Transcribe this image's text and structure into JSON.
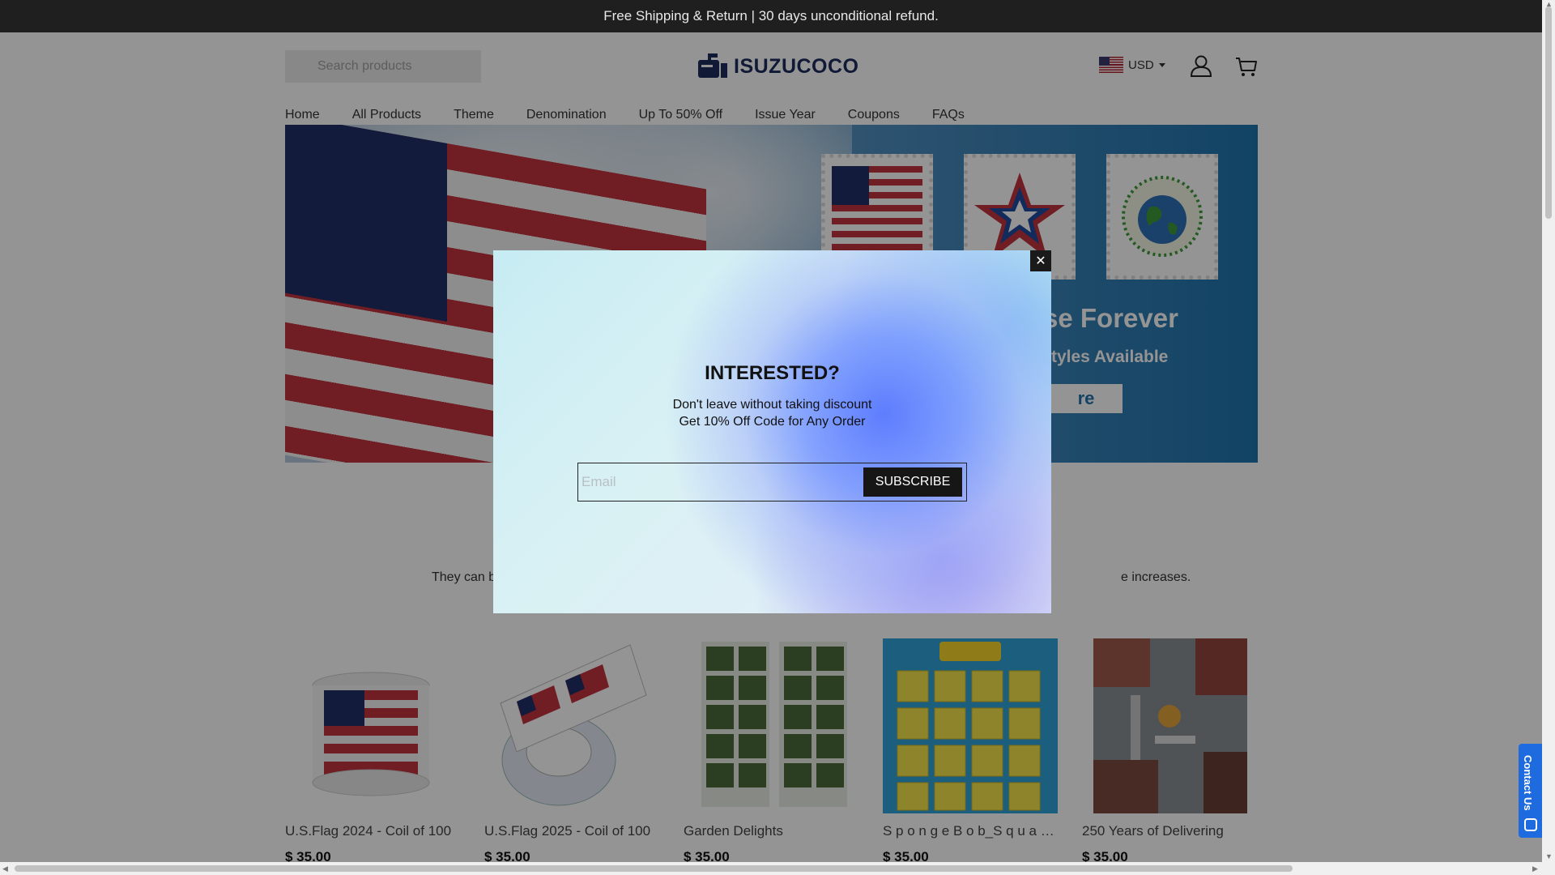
{
  "announcement": "Free Shipping & Return | 30 days unconditional refund.",
  "header": {
    "search_placeholder": "Search products",
    "logo_text": "ISUZUCOCO",
    "currency": "USD"
  },
  "nav": [
    "Home",
    "All Products",
    "Theme",
    "Denomination",
    "Up To 50% Off",
    "Issue Year",
    "Coupons",
    "FAQs"
  ],
  "hero": {
    "title_partial": "se Forever",
    "subtitle_partial": "tyles Available",
    "button_partial": "re"
  },
  "section": {
    "text_left": "They can be",
    "text_right": "e increases."
  },
  "products": [
    {
      "name": "U.S.Flag 2024 - Coil of 100",
      "price": "$ 35.00"
    },
    {
      "name": "U.S.Flag 2025 - Coil of 100",
      "price": "$ 35.00"
    },
    {
      "name": "Garden Delights",
      "price": "$ 35.00"
    },
    {
      "name": "S p o n g e B o b_S q u a r e...",
      "price": "$ 35.00"
    },
    {
      "name": "250 Years of Delivering",
      "price": "$ 35.00"
    }
  ],
  "popup": {
    "title": "INTERESTED?",
    "line1": "Don't leave without taking discount",
    "line2": "Get 10% Off Code for Any Order",
    "email_placeholder": "Email",
    "submit_label": "SUBSCRIBE"
  },
  "contact": {
    "label": "Contact Us"
  },
  "icons": {
    "search": "search-icon",
    "account": "user-icon",
    "cart": "cart-icon",
    "close": "close-icon",
    "chat": "chat-icon"
  },
  "colors": {
    "topbar": "#1f1f1f",
    "logo": "#1d2c5c",
    "contact": "#1e6be0",
    "subscribe": "#161616"
  }
}
